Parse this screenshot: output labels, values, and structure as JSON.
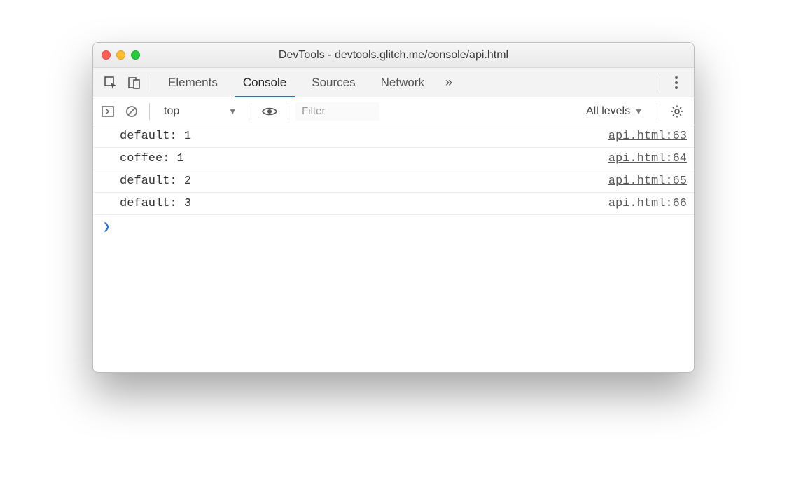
{
  "window": {
    "title": "DevTools - devtools.glitch.me/console/api.html"
  },
  "tabs": {
    "items": [
      "Elements",
      "Console",
      "Sources",
      "Network"
    ],
    "active_index": 1,
    "overflow_glyph": "»"
  },
  "console_toolbar": {
    "context": "top",
    "filter_placeholder": "Filter",
    "levels_label": "All levels"
  },
  "logs": [
    {
      "message": "default: 1",
      "source": "api.html:63"
    },
    {
      "message": "coffee: 1",
      "source": "api.html:64"
    },
    {
      "message": "default: 2",
      "source": "api.html:65"
    },
    {
      "message": "default: 3",
      "source": "api.html:66"
    }
  ],
  "prompt": {
    "glyph": "❯",
    "value": ""
  }
}
